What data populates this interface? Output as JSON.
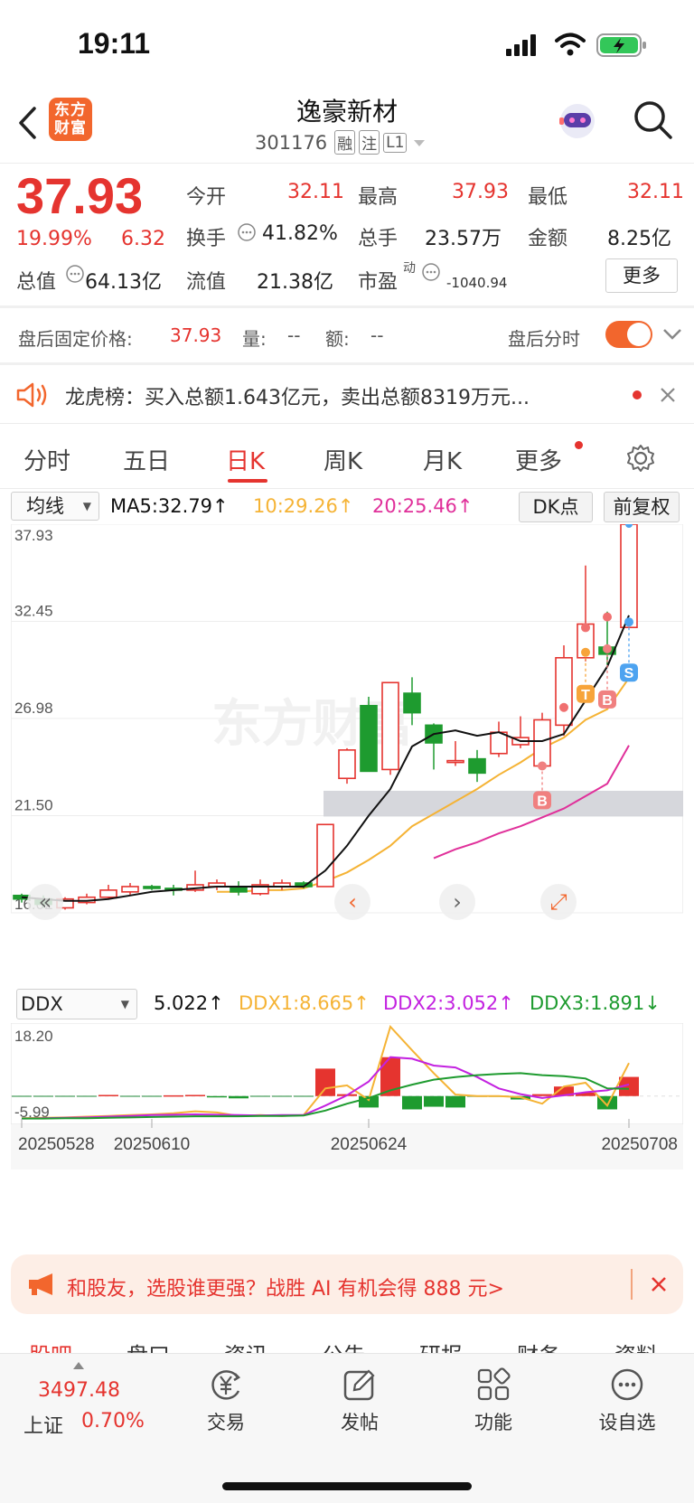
{
  "status": {
    "time": "19:11"
  },
  "header": {
    "title": "逸豪新材",
    "code": "301176",
    "tags": [
      "融",
      "注",
      "L1"
    ],
    "logo_text": "东方财富"
  },
  "quote": {
    "price": "37.93",
    "change_pct": "19.99%",
    "change": "6.32",
    "open_label": "今开",
    "open": "32.11",
    "high_label": "最高",
    "high": "37.93",
    "low_label": "最低",
    "low": "32.11",
    "turnover_label": "换手",
    "turnover": "41.82%",
    "volume_label": "总手",
    "volume": "23.57万",
    "amount_label": "金额",
    "amount": "8.25亿",
    "mktcap_label": "总值",
    "mktcap": "64.13亿",
    "float_label": "流值",
    "float": "21.38亿",
    "pe_label": "市盈",
    "pe_sup": "动",
    "pe": "-1040.94",
    "more": "更多"
  },
  "afterhours": {
    "label": "盘后固定价格:",
    "price": "37.93",
    "vol_label": "量:",
    "vol": "--",
    "amt_label": "额:",
    "amt": "--",
    "toggle_label": "盘后分时"
  },
  "notice": {
    "text": "龙虎榜：买入总额1.643亿元，卖出总额8319万元..."
  },
  "tabs": [
    "分时",
    "五日",
    "日K",
    "周K",
    "月K",
    "更多"
  ],
  "ma_bar": {
    "selector": "均线",
    "ma5": "MA5:32.79↑",
    "ma10": "10:29.26↑",
    "ma20": "20:25.46↑",
    "dk": "DK点",
    "adjust": "前复权"
  },
  "ddx_bar": {
    "selector": "DDX",
    "ddx": "5.022↑",
    "ddx1": "DDX1:8.665↑",
    "ddx2": "DDX2:3.052↑",
    "ddx3": "DDX3:1.891↓"
  },
  "colors": {
    "up": "#e5342f",
    "down": "#1e9b2f",
    "ma5": "#111111",
    "ma10": "#f5b335",
    "ma20": "#e0309a",
    "accent": "#f2662d"
  },
  "chart_data": [
    {
      "type": "candlestick",
      "y_ticks": [
        "37.93",
        "32.45",
        "26.98",
        "21.50",
        "16.02"
      ],
      "ylim": [
        16.02,
        37.93
      ],
      "x_labels": [
        "20250528",
        "20250610",
        "20250624",
        "20250708"
      ],
      "candles": [
        {
          "o": 17.0,
          "c": 16.8,
          "h": 17.1,
          "l": 16.6
        },
        {
          "o": 16.8,
          "c": 16.5,
          "h": 17.0,
          "l": 16.3
        },
        {
          "o": 16.3,
          "c": 16.8,
          "h": 16.9,
          "l": 16.2
        },
        {
          "o": 16.6,
          "c": 16.9,
          "h": 17.1,
          "l": 16.5
        },
        {
          "o": 16.9,
          "c": 17.3,
          "h": 17.6,
          "l": 16.8
        },
        {
          "o": 17.2,
          "c": 17.5,
          "h": 17.7,
          "l": 17.0
        },
        {
          "o": 17.5,
          "c": 17.4,
          "h": 17.6,
          "l": 17.3
        },
        {
          "o": 17.4,
          "c": 17.3,
          "h": 17.6,
          "l": 17.0
        },
        {
          "o": 17.3,
          "c": 17.6,
          "h": 18.4,
          "l": 17.2
        },
        {
          "o": 17.5,
          "c": 17.7,
          "h": 17.9,
          "l": 17.3
        },
        {
          "o": 17.5,
          "c": 17.2,
          "h": 17.8,
          "l": 17.0
        },
        {
          "o": 17.1,
          "c": 17.6,
          "h": 17.9,
          "l": 17.0
        },
        {
          "o": 17.5,
          "c": 17.7,
          "h": 17.9,
          "l": 17.3
        },
        {
          "o": 17.7,
          "c": 17.5,
          "h": 17.8,
          "l": 17.4
        },
        {
          "o": 17.5,
          "c": 21.0,
          "h": 21.0,
          "l": 17.5
        },
        {
          "o": 23.6,
          "c": 25.2,
          "h": 25.3,
          "l": 23.3
        },
        {
          "o": 27.7,
          "c": 24.0,
          "h": 28.2,
          "l": 24.0
        },
        {
          "o": 24.1,
          "c": 29.0,
          "h": 29.0,
          "l": 23.8
        },
        {
          "o": 28.4,
          "c": 27.3,
          "h": 29.3,
          "l": 26.6
        },
        {
          "o": 26.6,
          "c": 25.6,
          "h": 26.7,
          "l": 24.1
        },
        {
          "o": 24.5,
          "c": 24.6,
          "h": 25.7,
          "l": 24.3
        },
        {
          "o": 24.7,
          "c": 23.9,
          "h": 25.2,
          "l": 23.4
        },
        {
          "o": 25.0,
          "c": 26.2,
          "h": 26.8,
          "l": 24.8
        },
        {
          "o": 25.5,
          "c": 25.9,
          "h": 27.1,
          "l": 25.3
        },
        {
          "o": 24.3,
          "c": 26.9,
          "h": 27.3,
          "l": 24.1
        },
        {
          "o": 26.6,
          "c": 30.4,
          "h": 31.1,
          "l": 26.0
        },
        {
          "o": 30.4,
          "c": 32.3,
          "h": 35.6,
          "l": 30.2
        },
        {
          "o": 31.0,
          "c": 30.6,
          "h": 33.0,
          "l": 30.0
        },
        {
          "o": 32.11,
          "c": 37.93,
          "h": 37.93,
          "l": 32.11
        }
      ],
      "ma5": [
        16.9,
        16.8,
        16.7,
        16.7,
        16.8,
        17.0,
        17.2,
        17.3,
        17.4,
        17.5,
        17.5,
        17.5,
        17.5,
        17.5,
        18.4,
        19.8,
        21.5,
        23.0,
        25.4,
        26.1,
        26.3,
        26.0,
        26.2,
        25.7,
        25.7,
        26.1,
        28.0,
        29.9,
        32.79
      ],
      "ma10": [
        null,
        null,
        null,
        null,
        null,
        null,
        null,
        null,
        null,
        17.2,
        17.2,
        17.3,
        17.3,
        17.4,
        17.8,
        18.3,
        19.0,
        19.8,
        20.9,
        21.6,
        22.3,
        23.0,
        23.8,
        24.5,
        25.3,
        25.9,
        26.9,
        27.5,
        29.26
      ],
      "ma20": [
        null,
        null,
        null,
        null,
        null,
        null,
        null,
        null,
        null,
        null,
        null,
        null,
        null,
        null,
        null,
        null,
        null,
        null,
        null,
        19.1,
        19.6,
        20.0,
        20.5,
        20.9,
        21.4,
        21.9,
        22.6,
        23.3,
        25.46
      ],
      "signals": [
        {
          "i": 24,
          "label": "B",
          "pos": "below"
        },
        {
          "i": 26,
          "label": "T",
          "pos": "above"
        },
        {
          "i": 27,
          "label": "B",
          "pos": "above"
        },
        {
          "i": 28,
          "label": "S",
          "pos": "above"
        }
      ]
    },
    {
      "type": "bar",
      "name": "DDX",
      "y_ticks": [
        "18.20",
        "-5.99"
      ],
      "ylim": [
        -5.99,
        18.2
      ],
      "values": [
        0,
        0,
        0,
        0,
        0.3,
        0,
        0,
        0.2,
        0.3,
        -0.2,
        -0.6,
        0,
        0,
        0,
        7.2,
        0.5,
        -3.0,
        10.2,
        -3.5,
        -2.8,
        -3.0,
        0,
        0,
        -0.9,
        0.5,
        2.5,
        0.9,
        -3.5,
        5.022
      ],
      "ddx1": [
        -5.8,
        -5.7,
        -5.6,
        -5.4,
        -5.2,
        -5.0,
        -4.8,
        -4.5,
        -4.0,
        -4.3,
        -5.2,
        -5.0,
        -5.2,
        -5.0,
        2.0,
        2.8,
        -1.0,
        18.2,
        12.0,
        6.0,
        0.4,
        0,
        0,
        -0.3,
        -2.0,
        2.5,
        3.5,
        -2.5,
        8.665
      ],
      "ddx2": [
        -5.9,
        -5.8,
        -5.7,
        -5.6,
        -5.4,
        -5.2,
        -5.0,
        -4.9,
        -4.8,
        -4.9,
        -5.0,
        -5.1,
        -5.0,
        -5.0,
        -2.5,
        0.2,
        3.8,
        10.2,
        9.8,
        8.0,
        7.5,
        5.0,
        2.0,
        0.5,
        -0.5,
        0.2,
        1.0,
        1.5,
        3.052
      ],
      "ddx3": [
        -5.9,
        -5.9,
        -5.8,
        -5.8,
        -5.7,
        -5.6,
        -5.5,
        -5.4,
        -5.3,
        -5.3,
        -5.3,
        -5.2,
        -5.2,
        -5.1,
        -3.8,
        -2.0,
        -0.5,
        1.5,
        3.0,
        4.3,
        5.0,
        5.5,
        5.8,
        6.0,
        5.5,
        5.2,
        4.6,
        2.0,
        1.891
      ]
    }
  ],
  "promo": {
    "text": "和股友，选股谁更强？战胜 AI 有机会得 888 元>"
  },
  "subtabs": [
    "股吧",
    "盘口",
    "资讯",
    "公告",
    "研报",
    "财务",
    "资料"
  ],
  "index": {
    "value": "3497.48",
    "name": "上证",
    "pct": "0.70%"
  },
  "nav": [
    "交易",
    "发帖",
    "功能",
    "设自选"
  ]
}
